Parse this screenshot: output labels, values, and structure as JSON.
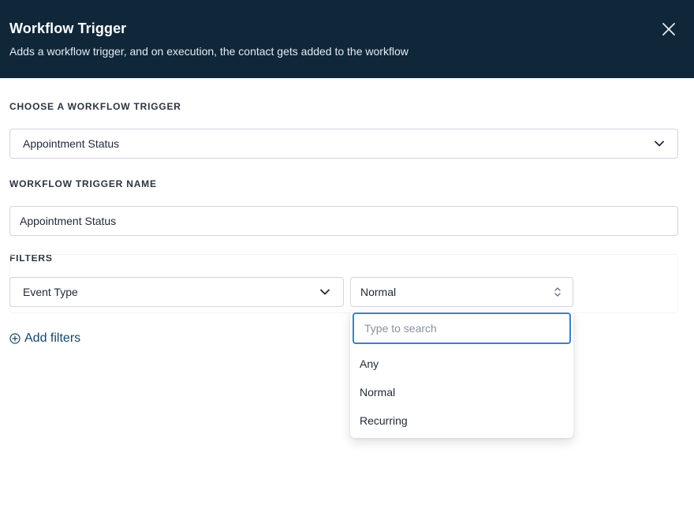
{
  "header": {
    "title": "Workflow Trigger",
    "subtitle": "Adds a workflow trigger, and on execution, the contact gets added to the workflow"
  },
  "trigger_section": {
    "label": "CHOOSE A WORKFLOW TRIGGER",
    "selected": "Appointment Status"
  },
  "name_section": {
    "label": "WORKFLOW TRIGGER NAME",
    "value": "Appointment Status"
  },
  "filters_section": {
    "label": "FILTERS",
    "field_select": "Event Type",
    "value_select": "Normal",
    "add_filters_label": "Add filters"
  },
  "dropdown": {
    "search_placeholder": "Type to search",
    "options": [
      "Any",
      "Normal",
      "Recurring"
    ]
  },
  "colors": {
    "header_bg": "#10273a",
    "link": "#14466b",
    "focus_border": "#3b82c4"
  },
  "icons": [
    "close-icon",
    "chevron-down-icon",
    "sort-icon",
    "plus-circle-icon"
  ]
}
